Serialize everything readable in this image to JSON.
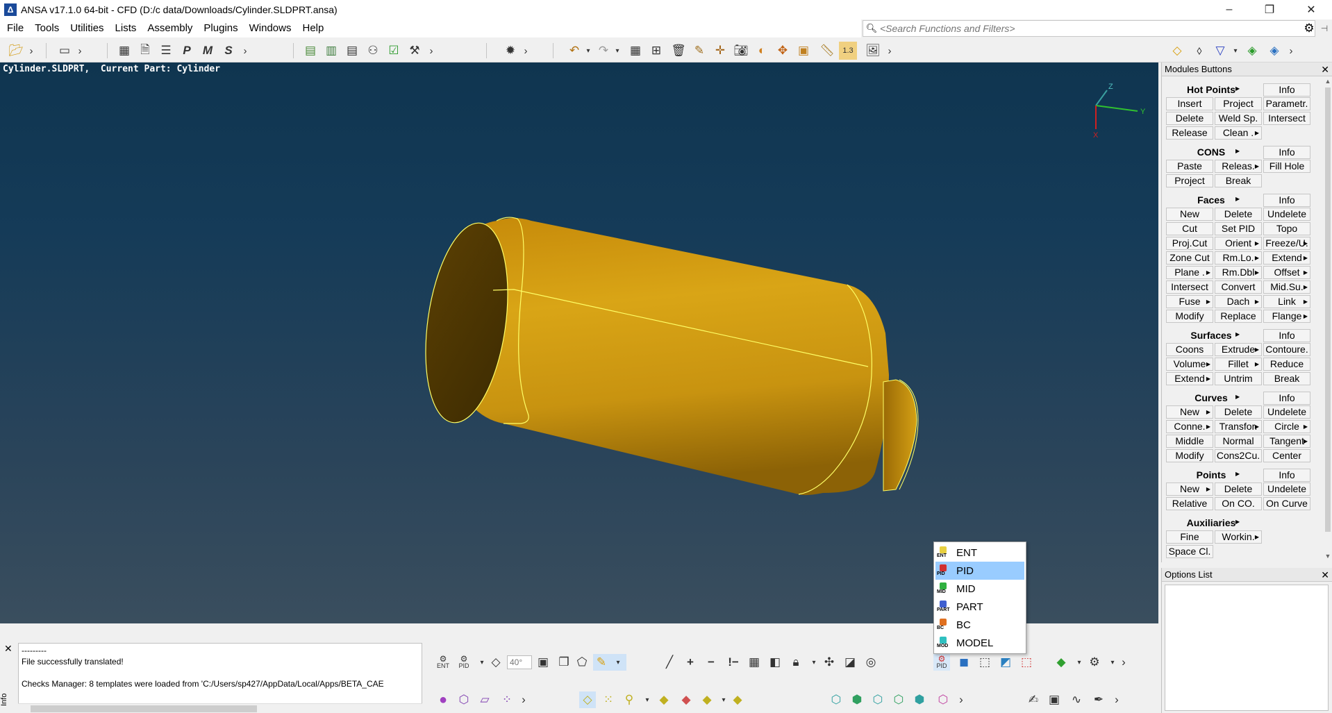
{
  "titlebar": {
    "title": "ANSA v17.1.0 64-bit - CFD (D:/c data/Downloads/Cylinder.SLDPRT.ansa)",
    "minimize": "–",
    "restore": "❐",
    "close": "✕"
  },
  "menubar": {
    "items": [
      "File",
      "Tools",
      "Utilities",
      "Lists",
      "Assembly",
      "Plugins",
      "Windows",
      "Help"
    ]
  },
  "search": {
    "placeholder": "<Search Functions and Filters>"
  },
  "viewport": {
    "file_label": "Cylinder.SLDPRT,",
    "current_part": "Current Part: Cylinder",
    "axis_x": "X",
    "axis_y": "Y",
    "axis_z": "Z",
    "colors": {
      "part": "#d4a012",
      "edge": "#ffff66",
      "bg_top": "#0f3550",
      "bg_bottom": "#3a4e5e"
    }
  },
  "modules": {
    "title": "Modules Buttons",
    "groups": [
      {
        "name": "Hot Points",
        "info": "Info",
        "rows": [
          [
            "Insert",
            "Project",
            "Parametr."
          ],
          [
            "Delete",
            "Weld Sp.",
            "Intersect"
          ],
          [
            "Release",
            "Clean .",
            ""
          ]
        ]
      },
      {
        "name": "CONS",
        "info": "Info",
        "rows": [
          [
            "Paste",
            "Releas.",
            "Fill Hole"
          ],
          [
            "Project",
            "Break",
            ""
          ]
        ]
      },
      {
        "name": "Faces",
        "info": "Info",
        "rows": [
          [
            "New",
            "Delete",
            "Undelete"
          ],
          [
            "Cut",
            "Set PID",
            "Topo"
          ],
          [
            "Proj.Cut",
            "Orient",
            "Freeze/U."
          ],
          [
            "Zone Cut",
            "Rm.Lo.",
            "Extend"
          ],
          [
            "Plane .",
            "Rm.Dbl",
            "Offset"
          ],
          [
            "Intersect",
            "Convert",
            "Mid.Su."
          ],
          [
            "Fuse",
            "Dach",
            "Link"
          ],
          [
            "Modify",
            "Replace",
            "Flange"
          ]
        ]
      },
      {
        "name": "Surfaces",
        "info": "Info",
        "rows": [
          [
            "Coons",
            "Extrude",
            "Contoure."
          ],
          [
            "Volume",
            "Fillet",
            "Reduce"
          ],
          [
            "Extend",
            "Untrim",
            "Break"
          ]
        ]
      },
      {
        "name": "Curves",
        "info": "Info",
        "rows": [
          [
            "New",
            "Delete",
            "Undelete"
          ],
          [
            "Conne.",
            "Transfor.",
            "Circle"
          ],
          [
            "Middle",
            "Normal",
            "Tangent"
          ],
          [
            "Modify",
            "Cons2Cu.",
            "Center"
          ]
        ]
      },
      {
        "name": "Points",
        "info": "Info",
        "rows": [
          [
            "New",
            "Delete",
            "Undelete"
          ],
          [
            "Relative",
            "On CO.",
            "On Curve"
          ]
        ]
      },
      {
        "name": "Auxiliaries",
        "info": "",
        "rows": [
          [
            "Fine",
            "Workin.",
            ""
          ],
          [
            "Space Cl.",
            "",
            ""
          ]
        ]
      }
    ]
  },
  "options": {
    "title": "Options List"
  },
  "messages": {
    "lines": [
      "---------",
      "File successfully translated!",
      "",
      "Checks Manager: 8 templates were loaded from 'C:/Users/sp427/AppData/Local/Apps/BETA_CAE"
    ],
    "side_label": "Info"
  },
  "bottom_toolbar": {
    "ent_label": "ENT",
    "pid_label": "PID",
    "angle": "40°",
    "pid_button": "PID"
  },
  "popup": {
    "items": [
      {
        "label": "ENT",
        "tag": "ENT",
        "color": "#e8d040",
        "selected": false
      },
      {
        "label": "PID",
        "tag": "PID",
        "color": "#d03030",
        "selected": true
      },
      {
        "label": "MID",
        "tag": "MID",
        "color": "#30b040",
        "selected": false
      },
      {
        "label": "PART",
        "tag": "PART",
        "color": "#4060d0",
        "selected": false
      },
      {
        "label": "BC",
        "tag": "BC",
        "color": "#e07020",
        "selected": false
      },
      {
        "label": "MODEL",
        "tag": "MOD",
        "color": "#30c0c0",
        "selected": false
      }
    ]
  }
}
